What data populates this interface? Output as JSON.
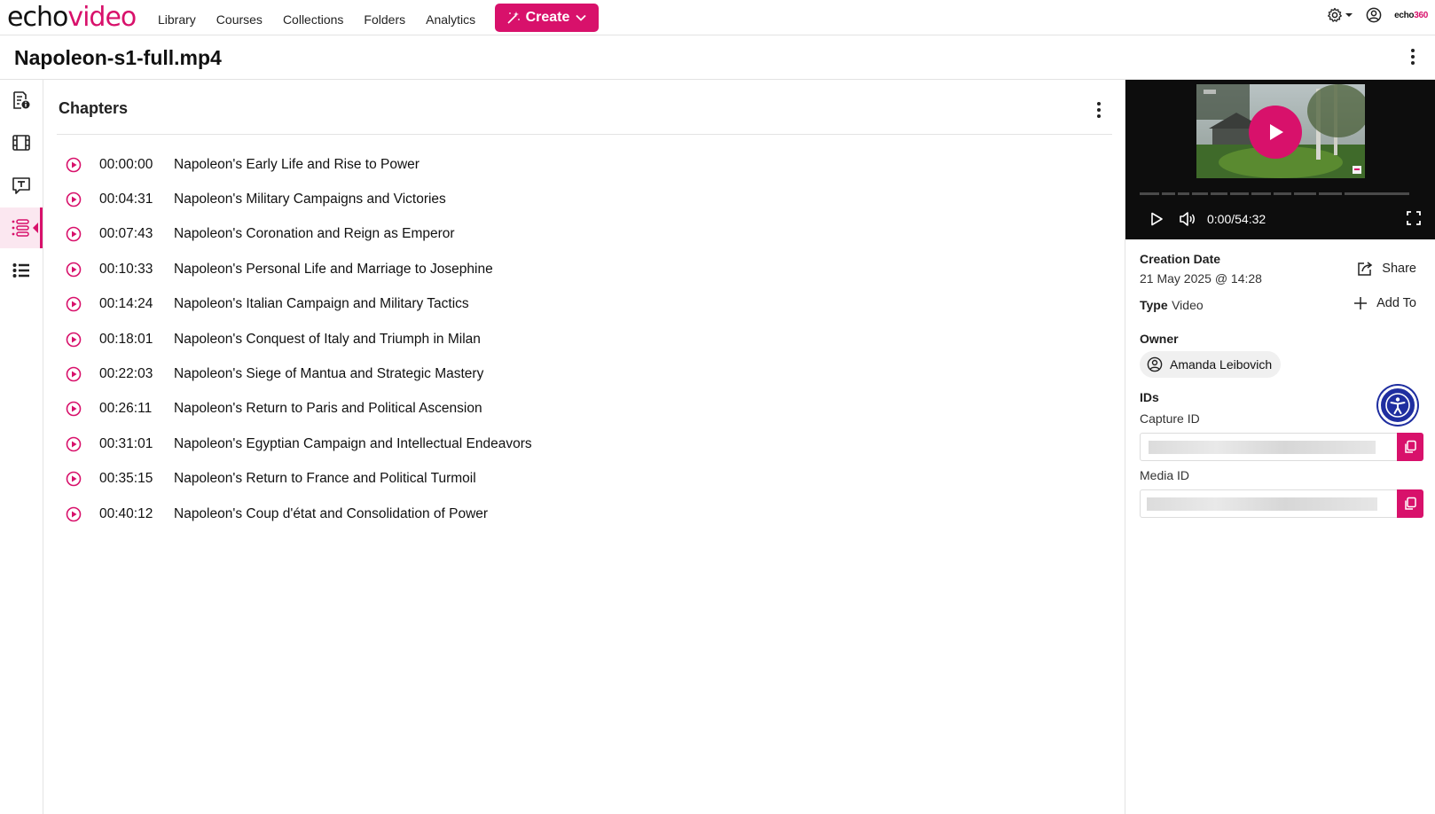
{
  "brand": {
    "part1": "echo",
    "part2": "video",
    "small_logo_a": "echo",
    "small_logo_b": "360"
  },
  "nav": {
    "links": [
      "Library",
      "Courses",
      "Collections",
      "Folders",
      "Analytics"
    ],
    "create_label": "Create"
  },
  "page": {
    "title": "Napoleon-s1-full.mp4"
  },
  "chapters": {
    "title": "Chapters",
    "items": [
      {
        "time": "00:00:00",
        "name": "Napoleon's Early Life and Rise to Power"
      },
      {
        "time": "00:04:31",
        "name": "Napoleon's Military Campaigns and Victories"
      },
      {
        "time": "00:07:43",
        "name": "Napoleon's Coronation and Reign as Emperor"
      },
      {
        "time": "00:10:33",
        "name": "Napoleon's Personal Life and Marriage to Josephine"
      },
      {
        "time": "00:14:24",
        "name": "Napoleon's Italian Campaign and Military Tactics"
      },
      {
        "time": "00:18:01",
        "name": "Napoleon's Conquest of Italy and Triumph in Milan"
      },
      {
        "time": "00:22:03",
        "name": "Napoleon's Siege of Mantua and Strategic Mastery"
      },
      {
        "time": "00:26:11",
        "name": "Napoleon's Return to Paris and Political Ascension"
      },
      {
        "time": "00:31:01",
        "name": "Napoleon's Egyptian Campaign and Intellectual Endeavors"
      },
      {
        "time": "00:35:15",
        "name": "Napoleon's Return to France and Political Turmoil"
      },
      {
        "time": "00:40:12",
        "name": "Napoleon's Coup d'état and Consolidation of Power"
      }
    ]
  },
  "player": {
    "time": "0:00/54:32"
  },
  "details": {
    "creation_label": "Creation Date",
    "creation_value": "21 May 2025 @ 14:28",
    "type_label": "Type",
    "type_value": "Video",
    "share_label": "Share",
    "addto_label": "Add To",
    "owner_label": "Owner",
    "owner_name": "Amanda Leibovich",
    "ids_label": "IDs",
    "capture_label": "Capture ID",
    "media_label": "Media ID"
  },
  "colors": {
    "accent": "#d8116b",
    "a11y": "#1f2ea0"
  },
  "icons": [
    "settings-icon",
    "user-icon",
    "details-icon",
    "film-icon",
    "captions-icon",
    "chapters-icon",
    "list-icon",
    "play-circle-icon",
    "share-icon",
    "plus-icon",
    "copy-icon",
    "accessibility-icon"
  ]
}
